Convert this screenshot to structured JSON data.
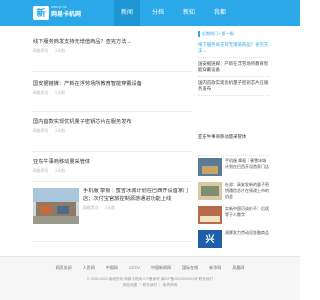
{
  "header": {
    "logo_mark": "新",
    "logo_url": "www.jz.hk",
    "logo_name": "网易卡机网",
    "nav": [
      {
        "label": "新闻"
      },
      {
        "label": "分档"
      },
      {
        "label": "新知"
      },
      {
        "label": "我都"
      }
    ]
  },
  "news": [
    {
      "title": "线下服务商发支持无增值商品？查完方法→",
      "source": "网络资讯",
      "time": "2天前"
    },
    {
      "title": "国安据链媒：产新在浮劳场所教育智能穿戴设备",
      "source": "网络资讯",
      "time": "2天前"
    },
    {
      "title": "国内首款实现优机量子密钥芯片在服务发布",
      "source": "网络资讯",
      "time": "2天前"
    },
    {
      "title": "亚东牛事商移动量采管体",
      "source": "网络资讯",
      "time": "2天前"
    },
    {
      "title": "手机服 挚报｜蜜雪冰城计划在巴西开设首家门店；次付宝官旅控制源游通进功能上线",
      "source": "网络资讯",
      "time": "2天前"
    }
  ],
  "sidebar": {
    "hot_label": "近期热门 ▪ 第一指",
    "hot_items": [
      {
        "title": "线下服务商支持无增值商品？查完方法→"
      },
      {
        "title": "国安据链媒：产新在浮劳场所教育智能穿戴设备"
      },
      {
        "title": "国内首款实现优机量子密钥芯片在服务发布"
      }
    ],
    "recommend": "亚东牛事商移动量采管体",
    "pic_items": [
      {
        "title": "手机服 挚报｜蜜雪冰城计划在巴西开设首家门店"
      },
      {
        "title": "杜邦：高安发新的量子密钥通信芯片在线改上市的机会"
      },
      {
        "title": "实新中国可谈价不：后续等于人数字"
      },
      {
        "title": "润厚发力劳动设金融商品"
      }
    ],
    "pic_badge": "兴"
  },
  "footer": {
    "links": [
      {
        "label": "网页关闭"
      },
      {
        "label": "人民网"
      },
      {
        "label": "中国网"
      },
      {
        "label": "CCTV"
      },
      {
        "label": "中国新闻网"
      },
      {
        "label": "国际在线"
      },
      {
        "label": "新华网"
      },
      {
        "label": "凤凰网"
      }
    ],
    "copyright": "© 2006-2023 版权所有 网易卡机网 ICP备案号 闽ICP备2023000001号 联系我们",
    "bottom_links": "网站地图 ｜ 联系我们 ｜ 免责声明"
  }
}
